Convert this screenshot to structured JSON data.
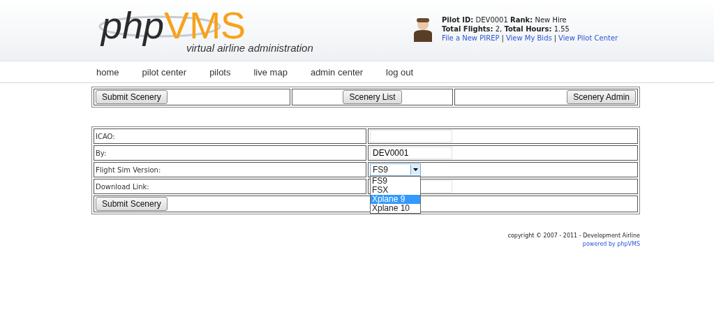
{
  "logo": {
    "part_1": "php",
    "part_2": "VMS",
    "tagline": "virtual airline administration"
  },
  "pilot": {
    "id_label": "Pilot ID:",
    "id": "DEV0001",
    "rank_label": "Rank:",
    "rank": "New Hire",
    "flights_label": "Total Flights:",
    "flights": "2,",
    "hours_label": "Total Hours:",
    "hours": "1.55",
    "links": [
      "File a New PIREP",
      "View My Bids",
      "View Pilot Center"
    ],
    "separator": "|"
  },
  "nav": [
    "home",
    "pilot center",
    "pilots",
    "live map",
    "admin center",
    "log out"
  ],
  "toolbar": [
    "Submit Scenery",
    "Scenery List",
    "Scenery Admin"
  ],
  "form": {
    "rows": [
      {
        "label": "ICAO:",
        "kind": "text",
        "value": ""
      },
      {
        "label": "By:",
        "kind": "text",
        "value": "DEV0001"
      },
      {
        "label": "Flight Sim Version:",
        "kind": "select",
        "value": "FS9",
        "expanded": true,
        "options": [
          {
            "label": "FS9",
            "highlighted": false
          },
          {
            "label": "FSX",
            "highlighted": false
          },
          {
            "label": "Xplane 9",
            "highlighted": true
          },
          {
            "label": "Xplane 10",
            "highlighted": false
          }
        ]
      },
      {
        "label": "Download Link:",
        "kind": "text",
        "value": ""
      }
    ],
    "submit": "Submit Scenery"
  },
  "footer": {
    "copyright": "copyright © 2007 - 2011 - Development Airline",
    "powered": "powered by phpVMS"
  }
}
